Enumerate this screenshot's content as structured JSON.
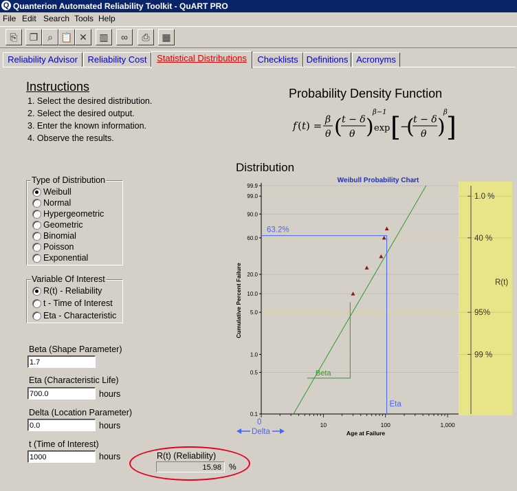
{
  "window": {
    "title": "Quanterion Automated Reliability Toolkit - QuART PRO"
  },
  "menu": [
    "File",
    "Edit",
    "Search",
    "Tools",
    "Help"
  ],
  "toolbar": {
    "icons": [
      "export-icon",
      "copy-icon",
      "find-replace-icon",
      "paste-icon",
      "delete-icon",
      "trash-icon",
      "binoculars-icon",
      "print-icon",
      "calculator-icon"
    ]
  },
  "tabs": [
    {
      "label": "Reliability Advisor",
      "active": false
    },
    {
      "label": "Reliability Cost",
      "active": false
    },
    {
      "label": "Statistical Distributions",
      "active": true
    },
    {
      "label": "Checklists",
      "active": false
    },
    {
      "label": "Definitions",
      "active": false
    },
    {
      "label": "Acronyms",
      "active": false
    }
  ],
  "instructions": {
    "title": "Instructions",
    "steps": [
      "1. Select the desired distribution.",
      "2. Select the desired output.",
      "3. Enter the known information.",
      "4. Observe the results."
    ]
  },
  "pdf": {
    "title": "Probability Density Function"
  },
  "distribution": {
    "title": "Distribution"
  },
  "type_of_distribution": {
    "legend": "Type of Distribution",
    "options": [
      "Weibull",
      "Normal",
      "Hypergeometric",
      "Geometric",
      "Binomial",
      "Poisson",
      "Exponential"
    ],
    "selected": "Weibull"
  },
  "variable_of_interest": {
    "legend": "Variable Of Interest",
    "options": [
      "R(t) - Reliability",
      "t - Time of Interest",
      "Eta - Characteristic"
    ],
    "selected": "R(t) - Reliability"
  },
  "fields": {
    "beta": {
      "label": "Beta (Shape Parameter)",
      "value": "1.7"
    },
    "eta": {
      "label": "Eta (Characteristic Life)",
      "value": "700.0",
      "units": "hours"
    },
    "delta": {
      "label": "Delta (Location Parameter)",
      "value": "0.0",
      "units": "hours"
    },
    "t": {
      "label": "t (Time of Interest)",
      "value": "1000",
      "units": "hours"
    }
  },
  "result": {
    "label": "R(t) (Reliability)",
    "value": "15.98",
    "units": "%"
  },
  "colors": {
    "annotation_oval": "#e8001c",
    "chart_title": "#2233aa",
    "guide_line": "#4466ff",
    "fit_line": "#2e9a2e",
    "reliability_band": "#e8e488"
  },
  "chart_data": {
    "type": "scatter",
    "title": "Weibull Probability Chart",
    "xlabel": "Age at Failure",
    "ylabel": "Cumulative Percent Failure",
    "x_scale": "log",
    "y_scale": "weibull",
    "xlim": [
      1,
      1500
    ],
    "ylim": [
      0.1,
      99.9
    ],
    "x_ticks": [
      {
        "v": 10,
        "label": "10"
      },
      {
        "v": 100,
        "label": "100"
      },
      {
        "v": 1000,
        "label": "1,000"
      }
    ],
    "y_ticks": [
      {
        "v": 99.9,
        "label": "99.9"
      },
      {
        "v": 99.0,
        "label": "99.0"
      },
      {
        "v": 90.0,
        "label": "90.0"
      },
      {
        "v": 60.0,
        "label": "60.0"
      },
      {
        "v": 20.0,
        "label": "20.0"
      },
      {
        "v": 10.0,
        "label": "10.0"
      },
      {
        "v": 5.0,
        "label": "5.0"
      },
      {
        "v": 1.0,
        "label": "1.0"
      },
      {
        "v": 0.5,
        "label": "0.5"
      },
      {
        "v": 0.1,
        "label": "0.1"
      }
    ],
    "points": [
      {
        "x": 30,
        "y": 10
      },
      {
        "x": 50,
        "y": 25
      },
      {
        "x": 85,
        "y": 36
      },
      {
        "x": 95,
        "y": 60
      },
      {
        "x": 105,
        "y": 73
      }
    ],
    "fit_line": [
      {
        "x": 3.3,
        "y": 0.1
      },
      {
        "x": 450,
        "y": 99.9
      }
    ],
    "eta_marker": {
      "x": 97,
      "y": 63.2,
      "label": "63.2%",
      "eta_label": "Eta"
    },
    "beta_marker": {
      "x_start": 5.5,
      "x_end": 27,
      "y_start": 0.4,
      "y_end": 7.3,
      "label": "Beta"
    },
    "delta_marker": {
      "value_label": "0",
      "label": "Delta"
    },
    "reliability_scale": {
      "label": "R(t)",
      "ticks": [
        {
          "y": 99,
          "label": "1.0 %"
        },
        {
          "y": 60,
          "label": "40 %"
        },
        {
          "y": 5,
          "label": "95%"
        },
        {
          "y": 1,
          "label": "99 %"
        }
      ]
    },
    "grid": true
  }
}
